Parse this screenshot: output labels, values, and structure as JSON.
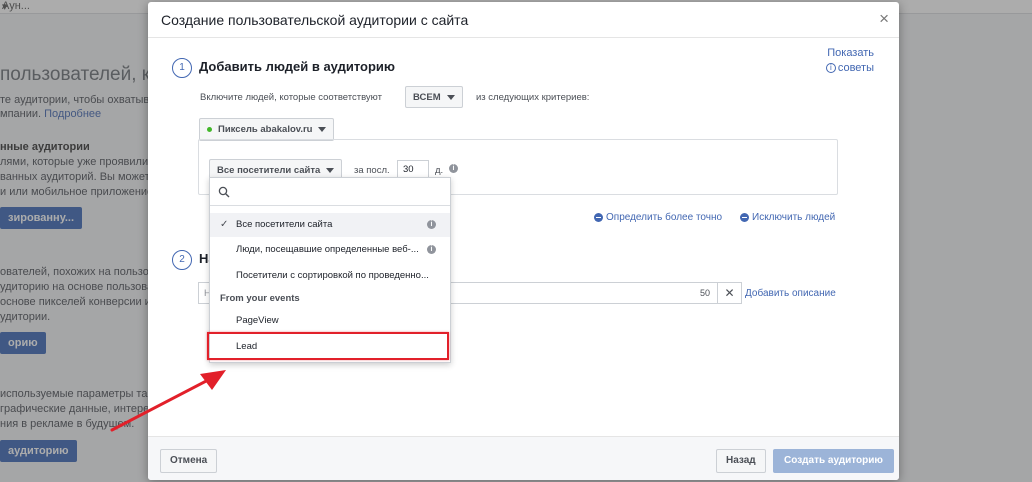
{
  "background": {
    "top_label": "Аун...",
    "heading": "пользователей, которы",
    "line1": "те аудитории, чтобы охватыв",
    "line2a": "мпании.",
    "line2_link": "Подробнее",
    "section1_title": "нные аудитории",
    "section1_l1": "лями, которые уже проявили инте",
    "section1_l2": "ванных аудиторий. Вы можете со",
    "section1_l3": "и или мобильное приложение.",
    "btn1": "зированну...",
    "section2_l1": "ователей, похожих на пользовате",
    "section2_l2": "удиторию на основе пользовате",
    "section2_l3": "основе пикселей конверсии или",
    "section2_l4": "удитории.",
    "btn2": "орию",
    "section3_l1": "используемые параметры таргет",
    "section3_l2": "графические данные, интересы",
    "section3_l3": "ния в рекламе в будущем.",
    "btn3": "аудиторию"
  },
  "modal": {
    "title": "Создание пользовательской аудитории с сайта",
    "close": "×",
    "tips_line1": "Показать",
    "tips_line2": "советы",
    "step1": {
      "number": "1",
      "title": "Добавить людей в аудиторию",
      "include_label": "Включите людей, которые соответствуют",
      "match_select": "ВСЕМ",
      "criteria_suffix": "из следующих критериев:",
      "pixel_select": "Пиксель abakalov.ru",
      "visitors_select": "Все посетители сайта",
      "period_label": "за посл.",
      "period_value": "30",
      "period_unit": "д.",
      "refine_link": "Определить более точно",
      "exclude_link": "Исключить людей"
    },
    "step2": {
      "number": "2",
      "title_prefix": "На",
      "name_prefix": "Н",
      "char_count": "50",
      "clear": "✕",
      "add_description": "Добавить описание"
    },
    "footer": {
      "cancel": "Отмена",
      "back": "Назад",
      "create": "Создать аудиторию"
    }
  },
  "dropdown": {
    "items": [
      {
        "label": "Все посетители сайта",
        "selected": true
      },
      {
        "label": "Люди, посещавшие определенные веб-..."
      },
      {
        "label": "Посетители с сортировкой по проведенно..."
      }
    ],
    "events_header": "From your events",
    "events": [
      {
        "label": "PageView"
      },
      {
        "label": "Lead"
      }
    ]
  },
  "colors": {
    "accent": "#4267b2",
    "highlight": "#e2202a",
    "pixel_status": "#42b72a"
  }
}
